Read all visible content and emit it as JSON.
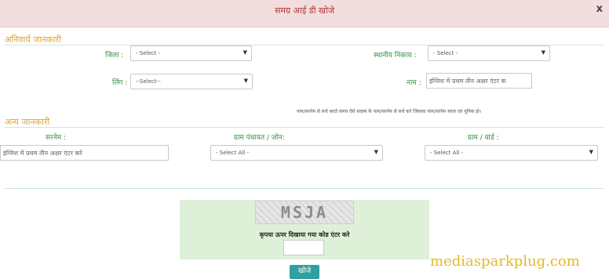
{
  "header": {
    "title": "समग्र आई डी खोजे",
    "close_label": "x"
  },
  "mandatory": {
    "section_title": "अनिवार्य जानकारी",
    "district_label": "जिला :",
    "district_value": "- Select -",
    "body_label": "स्थानीय निकाय :",
    "body_value": "- Select -",
    "gender_label": "लिंग :",
    "gender_value": "--Select--",
    "name_label": "नाम :",
    "name_placeholder": "इंग्लिश मे प्रथम तीन अक्षर एंटर क",
    "note": "नाम/सरनेम से सर्च करते समय ऐसे सदस्य के नाम/सरनेम से सर्च करे जिसका नाम/सरनेम सरल एवं यूनिक हो।"
  },
  "other": {
    "section_title": "अन्य जानकारी",
    "surname_label": "सरनेम :",
    "surname_placeholder": "इंग्लिश मे प्रथम तीन अक्षर एंटर करे",
    "panchayat_label": "ग्राम पंचायत / ज़ोन:",
    "panchayat_value": "- Select All -",
    "village_label": "ग्राम / वार्ड :",
    "village_value": "- Select All -"
  },
  "captcha": {
    "code": "MSJA",
    "prompt": "कृपया ऊपर दिखाया गया कोड एंटर करे",
    "input_value": ""
  },
  "submit_label": "खोजे",
  "watermark": "mediasparkplug.com"
}
